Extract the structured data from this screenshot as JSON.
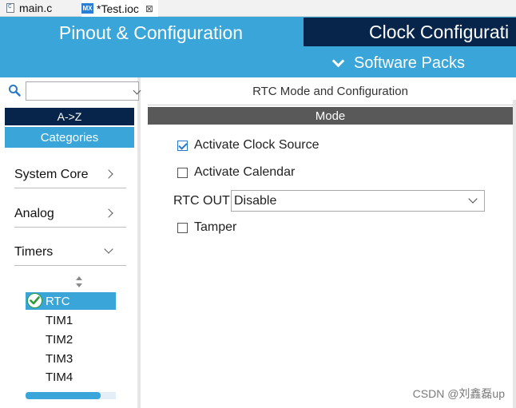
{
  "editor_tabs": [
    {
      "label": "main.c"
    },
    {
      "label": "*Test.ioc",
      "icon_text": "MX"
    }
  ],
  "header": {
    "pinout_tab": "Pinout & Configuration",
    "clock_tab": "Clock Configurati",
    "software_packs": "Software Packs"
  },
  "left_panel": {
    "search": {
      "value": ""
    },
    "az_button": "A->Z",
    "categories_button": "Categories",
    "categories": [
      {
        "label": "System Core",
        "expanded": false
      },
      {
        "label": "Analog",
        "expanded": false
      },
      {
        "label": "Timers",
        "expanded": true
      }
    ],
    "timer_items": [
      {
        "label": "RTC",
        "selected": true,
        "checked": true
      },
      {
        "label": "TIM1"
      },
      {
        "label": "TIM2"
      },
      {
        "label": "TIM3"
      },
      {
        "label": "TIM4"
      }
    ]
  },
  "right_panel": {
    "title": "RTC Mode and Configuration",
    "mode_header": "Mode",
    "options": [
      {
        "label": "Activate Clock Source",
        "checked": true
      },
      {
        "label": "Activate Calendar",
        "checked": false
      },
      {
        "label": "Tamper",
        "checked": false
      }
    ],
    "rtc_out": {
      "label": "RTC OUT",
      "value": "Disable"
    }
  },
  "watermark": "CSDN @刘鑫磊up",
  "colors": {
    "accent_blue": "#39a5d8",
    "navy": "#07254a",
    "mode_bar": "#595959",
    "check_green": "#2e9a3a"
  }
}
